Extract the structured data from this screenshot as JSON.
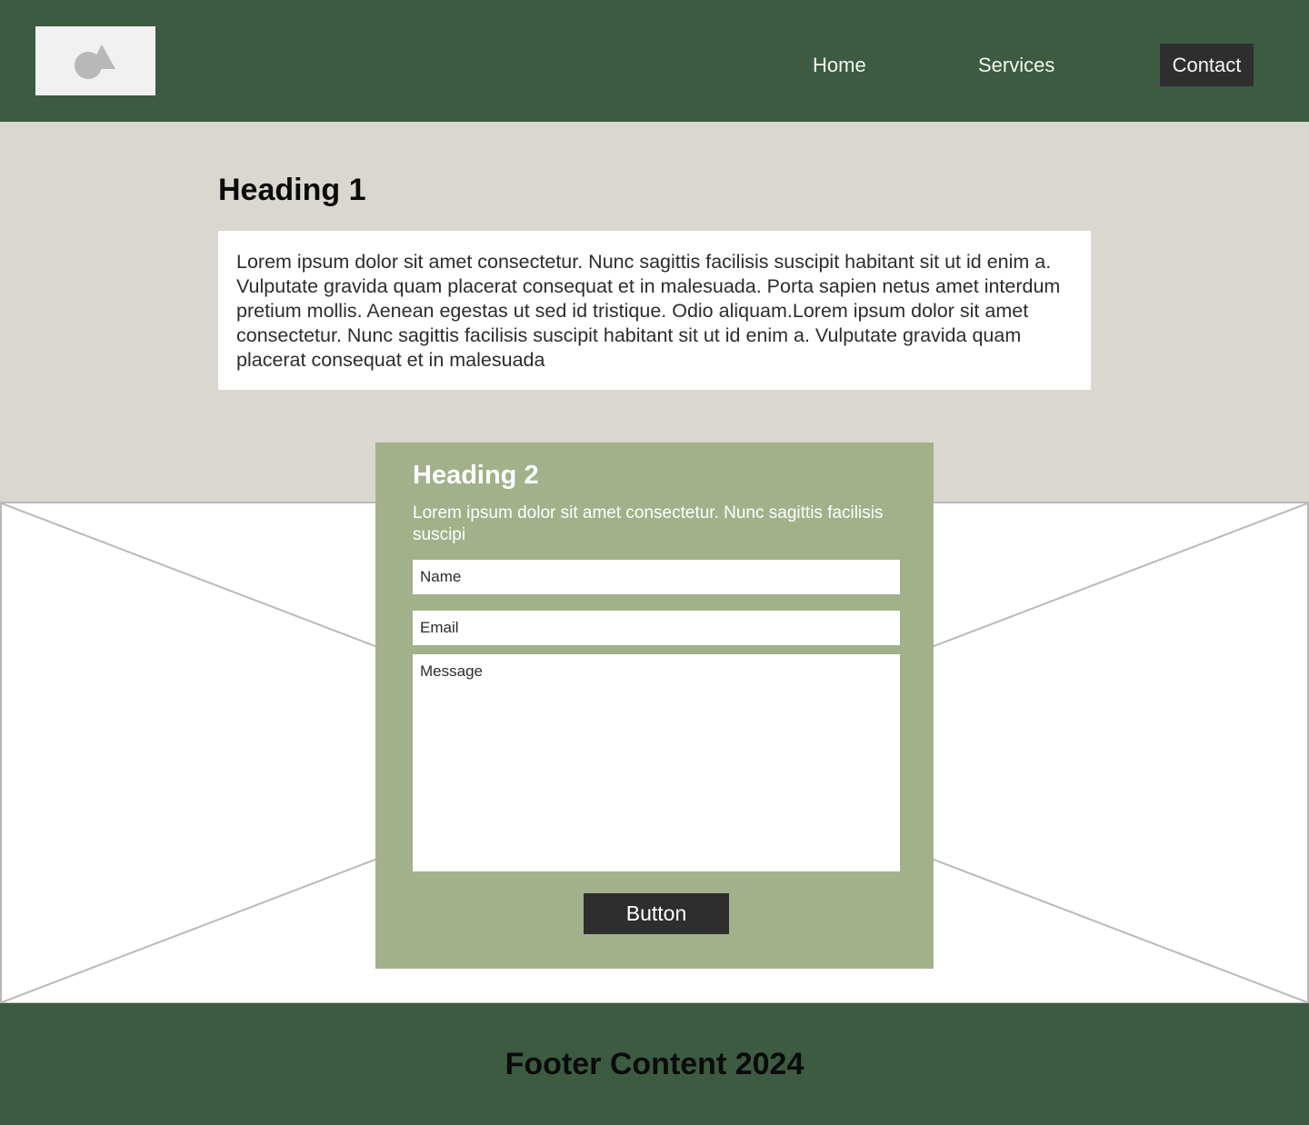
{
  "header": {
    "logo_icon": "shapes-icon",
    "nav": {
      "home": "Home",
      "services": "Services",
      "contact": "Contact"
    }
  },
  "hero": {
    "heading": "Heading 1",
    "paragraph": "Lorem ipsum dolor sit amet consectetur. Nunc sagittis facilisis suscipit habitant sit ut id enim a. Vulputate gravida quam placerat consequat et in malesuada. Porta sapien netus amet interdum pretium mollis. Aenean egestas ut sed id tristique. Odio aliquam.Lorem ipsum dolor sit amet consectetur. Nunc sagittis facilisis suscipit habitant sit ut id enim a. Vulputate gravida quam placerat consequat et in malesuada"
  },
  "contact_form": {
    "heading": "Heading 2",
    "description": "Lorem ipsum dolor sit amet consectetur. Nunc sagittis facilisis suscipi",
    "name_placeholder": "Name",
    "email_placeholder": "Email",
    "message_placeholder": "Message",
    "button_label": "Button"
  },
  "footer": {
    "text": "Footer Content 2024"
  },
  "colors": {
    "header_bg": "#3c5b41",
    "hero_bg": "#d9d7cf",
    "card_bg": "#a2b18a",
    "dark_button": "#2e2e2e"
  }
}
